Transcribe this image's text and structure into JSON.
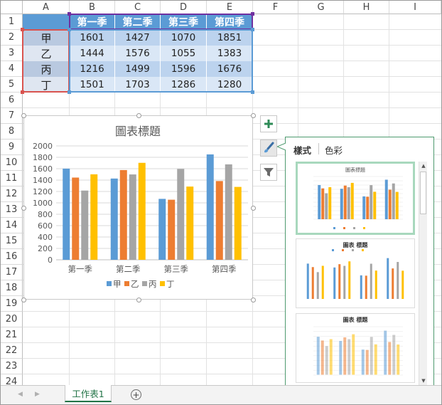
{
  "columns": [
    "A",
    "B",
    "C",
    "D",
    "E",
    "F",
    "G",
    "H",
    "I"
  ],
  "rows": [
    "1",
    "2",
    "3",
    "4",
    "5",
    "6",
    "7",
    "8",
    "9",
    "10",
    "11",
    "12",
    "13",
    "14",
    "15",
    "16",
    "17",
    "18",
    "19",
    "20",
    "21",
    "22",
    "23",
    "24",
    "25"
  ],
  "table": {
    "headers": [
      "第一季",
      "第二季",
      "第三季",
      "第四季"
    ],
    "rows": [
      {
        "name": "甲",
        "values": [
          "1601",
          "1427",
          "1070",
          "1851"
        ]
      },
      {
        "name": "乙",
        "values": [
          "1444",
          "1576",
          "1055",
          "1383"
        ]
      },
      {
        "name": "丙",
        "values": [
          "1216",
          "1499",
          "1596",
          "1676"
        ]
      },
      {
        "name": "丁",
        "values": [
          "1501",
          "1703",
          "1286",
          "1280"
        ]
      }
    ]
  },
  "chart_data": {
    "type": "bar",
    "title": "圖表標題",
    "categories": [
      "第一季",
      "第二季",
      "第三季",
      "第四季"
    ],
    "series": [
      {
        "name": "甲",
        "color": "#5b9bd5",
        "values": [
          1601,
          1427,
          1070,
          1851
        ]
      },
      {
        "name": "乙",
        "color": "#ed7d31",
        "values": [
          1444,
          1576,
          1055,
          1383
        ]
      },
      {
        "name": "丙",
        "color": "#a5a5a5",
        "values": [
          1216,
          1499,
          1596,
          1676
        ]
      },
      {
        "name": "丁",
        "color": "#ffc000",
        "values": [
          1501,
          1703,
          1286,
          1280
        ]
      }
    ],
    "ylim": [
      0,
      2000
    ],
    "yticks": [
      "2000",
      "1800",
      "1600",
      "1400",
      "1200",
      "1000",
      "800",
      "600",
      "400",
      "200",
      "0"
    ],
    "grid": true,
    "legend_position": "bottom"
  },
  "side_buttons": [
    {
      "name": "chart-elements",
      "icon": "plus-icon"
    },
    {
      "name": "chart-styles",
      "icon": "brush-icon"
    },
    {
      "name": "chart-filters",
      "icon": "filter-icon"
    }
  ],
  "panel": {
    "tabs": [
      "樣式",
      "色彩"
    ],
    "active_tab": "樣式",
    "thumbnails": [
      {
        "title": "圖表標題"
      },
      {
        "title": "圖表 標題"
      },
      {
        "title": "圖表 標題"
      }
    ]
  },
  "sheet": {
    "tabs": [
      "工作表1"
    ],
    "add_icon": "plus-circle-icon"
  },
  "colors": {
    "header_blue": "#5b9bd5",
    "row_name_band": "#bdd7ee",
    "row_data_dark": "#bcd3ee",
    "row_data_light": "#dae7f6",
    "selection_green": "#217346",
    "range_purple": "#7030a0",
    "range_red": "#d9534f"
  }
}
